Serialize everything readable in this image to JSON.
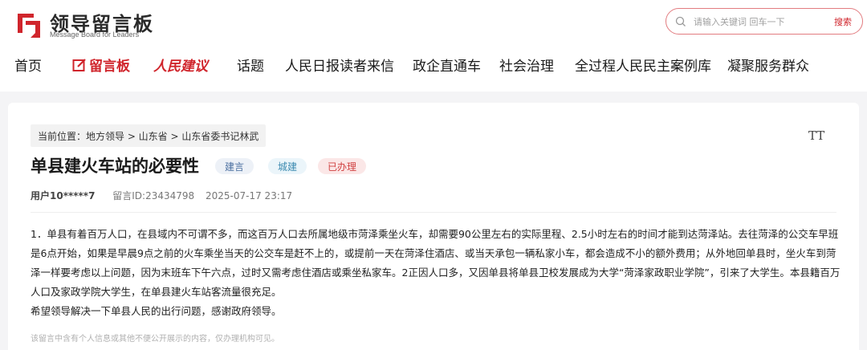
{
  "logo": {
    "title": "领导留言板",
    "subtitle": "Message Board for Leaders",
    "brand_color": "#d0252c"
  },
  "search": {
    "placeholder": "请输入关键词 回车一下",
    "button_label": "搜索"
  },
  "nav": {
    "items": [
      {
        "label": "首页"
      },
      {
        "label": "留言板",
        "active": true,
        "icon": "edit-icon"
      },
      {
        "label": "人民建议",
        "style": "red-calligraphy"
      },
      {
        "label": "话题"
      },
      {
        "label": "人民日报读者来信"
      },
      {
        "label": "政企直通车"
      },
      {
        "label": "社会治理"
      },
      {
        "label": "全过程人民民主案例库"
      },
      {
        "label": "凝聚服务群众"
      }
    ]
  },
  "breadcrumb": {
    "text": "当前位置：地方领导 > 山东省 > 山东省委书记林武"
  },
  "font_toggle": "TT",
  "message": {
    "title": "单县建火车站的必要性",
    "tags": [
      "建言",
      "城建",
      "已办理"
    ],
    "user": "用户10*****7",
    "id_text": "留言ID:23434798",
    "datetime": "2025-07-17 23:17",
    "paragraph_1": "1．单县有着百万人口，在县域内不可谓不多，而这百万人口去所属地级市菏泽乘坐火车，却需要90公里左右的实际里程、2.5小时左右的时间才能到达菏泽站。去往菏泽的公交车早班是6点开始，如果是早晨9点之前的火车乘坐当天的公交车是赶不上的，或提前一天在菏泽住酒店、或当天承包一辆私家小车，都会造成不小的额外费用；从外地回单县时，坐火车到菏泽一样要考虑以上问题，因为末班车下午六点，过时又需考虑住酒店或乘坐私家车。2正因人口多，又因单县将单县卫校发展成为大学“菏泽家政职业学院”，引来了大学生。本县籍百万人口及家政学院大学生，在单县建火车站客流量很充足。",
    "paragraph_2": "希望领导解决一下单县人民的出行问题，感谢政府领导。",
    "privacy_note": "该留言中含有个人信息或其他不便公开展示的内容，仅办理机构可见。"
  }
}
